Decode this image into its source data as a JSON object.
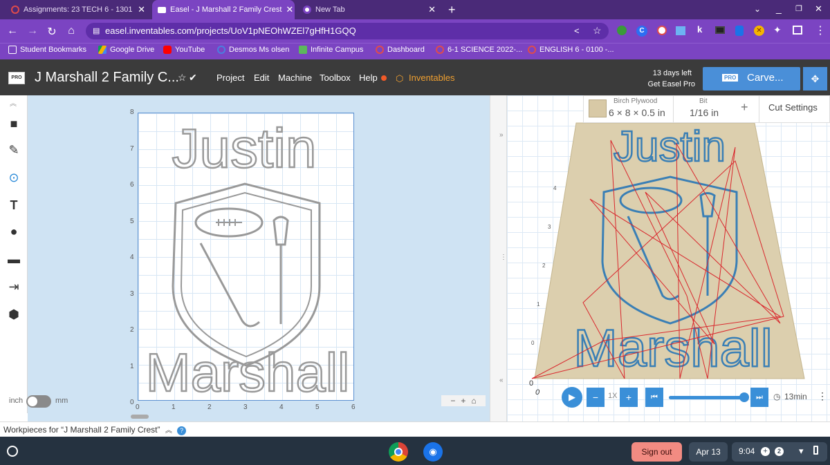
{
  "browser": {
    "tabs": [
      {
        "title": "Assignments: 23 TECH 6 - 1301",
        "icon": "loading-circle-icon",
        "color": "#e04b4b"
      },
      {
        "title": "Easel - J Marshall 2 Family Crest",
        "icon": "easel-window-icon",
        "color": "#ffffff"
      },
      {
        "title": "New Tab",
        "icon": "chrome-icon",
        "color": "#ffffff"
      }
    ],
    "new_tab": "+",
    "url": "easel.inventables.com/projects/UoV1pNEOhWZEl7gHfH1GQQ",
    "bookmarks": [
      {
        "label": "Student Bookmarks",
        "icon": "folder-icon",
        "color": "#f4f4f4"
      },
      {
        "label": "Google Drive",
        "icon": "drive-icon",
        "color": "#f5b400"
      },
      {
        "label": "YouTube",
        "icon": "youtube-icon",
        "color": "#ff0000"
      },
      {
        "label": "Desmos Ms olsen",
        "icon": "desmos-icon",
        "color": "#4a7fe0"
      },
      {
        "label": "Infinite Campus",
        "icon": "campus-icon",
        "color": "#5cb85c"
      },
      {
        "label": "Dashboard",
        "icon": "canvas-icon",
        "color": "#e04b4b"
      },
      {
        "label": "6-1 SCIENCE 2022-...",
        "icon": "canvas-icon",
        "color": "#e04b4b"
      },
      {
        "label": "ENGLISH 6 - 0100 -...",
        "icon": "canvas-icon",
        "color": "#e04b4b"
      }
    ]
  },
  "easel": {
    "badge": "PRO",
    "project_title": "J Marshall 2 Family C...",
    "menu": [
      "Project",
      "Edit",
      "Machine",
      "Toolbox",
      "Help"
    ],
    "inventables": "Inventables",
    "trial": {
      "days_left": "13 days left",
      "cta": "Get Easel Pro"
    },
    "carve_badge": "PRO",
    "carve_label": "Carve...",
    "colors": {
      "header": "#3b3b3b",
      "carve": "#4a8fd8",
      "accent": "#f08a24"
    }
  },
  "canvas": {
    "y_ticks": [
      "8",
      "7",
      "6",
      "5",
      "4",
      "3",
      "2",
      "1",
      "0"
    ],
    "x_ticks": [
      "0",
      "1",
      "2",
      "3",
      "4",
      "5",
      "6"
    ],
    "unit_left": "inch",
    "unit_right": "mm",
    "design_top_text": "Justin",
    "design_bottom_text": "Marshall"
  },
  "preview": {
    "material_label": "Birch Plywood",
    "material_size": "6 × 8 × 0.5 in",
    "bit_label": "Bit",
    "bit_size": "1/16 in",
    "add": "+",
    "cut_settings": "Cut Settings",
    "speed": "1X",
    "progress": 1.0,
    "time": "13min",
    "axis_left": [
      "4",
      "3",
      "2",
      "1",
      "0"
    ],
    "origin_x": "0",
    "origin_y": "0",
    "top_text": "Justin",
    "bottom_text": "Marshall"
  },
  "workpieces": "Workpieces for “J Marshall 2 Family Crest”",
  "shelf": {
    "sign_out": "Sign out",
    "date": "Apr 13",
    "time": "9:04",
    "notifications": "2"
  }
}
